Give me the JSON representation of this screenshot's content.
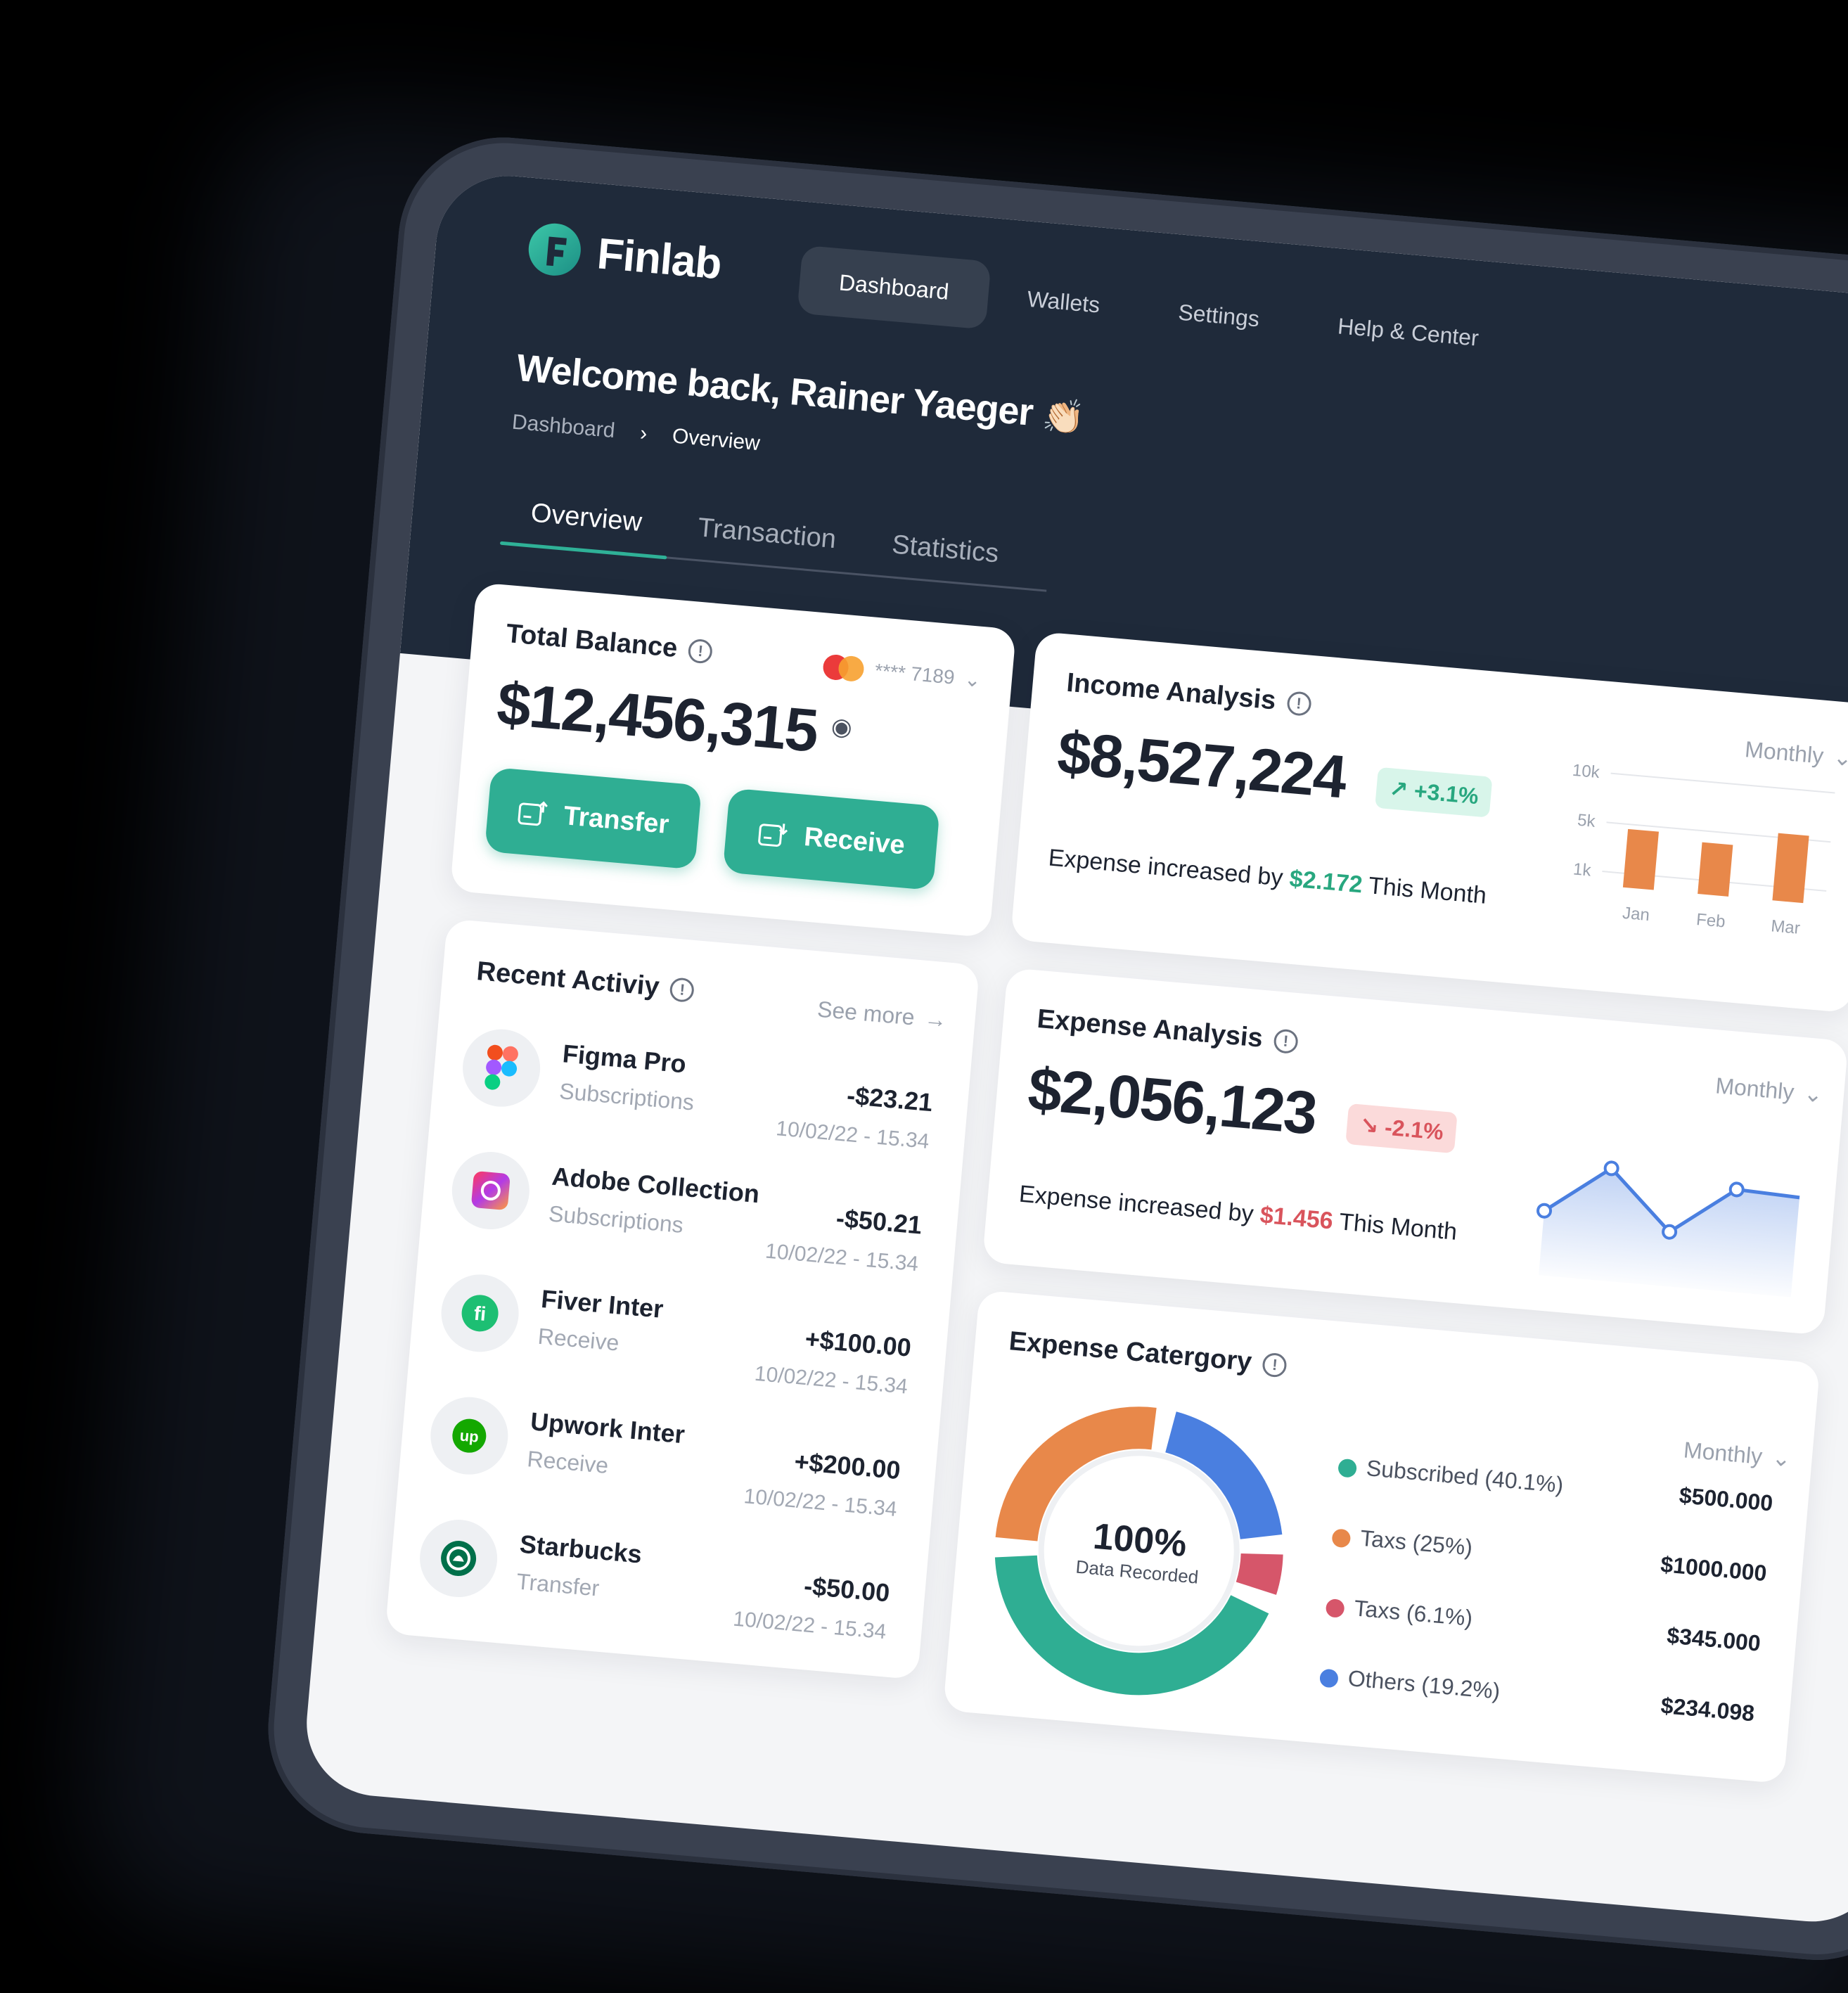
{
  "app": {
    "logo_text": "Finlab",
    "brand_color": "#2fae93",
    "dark_color": "#1f2a3a"
  },
  "nav": {
    "items": [
      {
        "label": "Dashboard",
        "active": true
      },
      {
        "label": "Wallets",
        "active": false
      },
      {
        "label": "Settings",
        "active": false
      },
      {
        "label": "Help & Center",
        "active": false
      }
    ]
  },
  "header": {
    "welcome": "Welcome back, Rainer Yaeger",
    "wave_emoji": "👏🏻",
    "breadcrumb": [
      "Dashboard",
      "Overview"
    ]
  },
  "tabs": [
    {
      "label": "Overview",
      "active": true
    },
    {
      "label": "Transaction",
      "active": false
    },
    {
      "label": "Statistics",
      "active": false
    }
  ],
  "balance": {
    "title": "Total Balance",
    "card_number": "**** 7189",
    "amount": "$12,456,315",
    "transfer_label": "Transfer",
    "receive_label": "Receive"
  },
  "income": {
    "title": "Income Analysis",
    "amount": "$8,527,224",
    "change": "+3.1%",
    "note_prefix": "Expense increased by",
    "note_value": "$2.172",
    "note_suffix": "This Month",
    "period": "Monthly",
    "chart_data": {
      "type": "bar",
      "categories": [
        "Jan",
        "Feb",
        "Mar"
      ],
      "values": [
        5.2,
        4.6,
        6.0
      ],
      "y_ticks": [
        "10k",
        "5k",
        "1k"
      ],
      "bar_color": "#e8884a"
    }
  },
  "expense": {
    "title": "Expense Analysis",
    "amount": "$2,056,123",
    "change": "-2.1%",
    "note_prefix": "Expense increased by",
    "note_value": "$1.456",
    "note_suffix": "This Month",
    "period": "Monthly",
    "chart_data": {
      "type": "line",
      "values": [
        40,
        78,
        32,
        70,
        68
      ],
      "line_color": "#4a7fe0"
    }
  },
  "category": {
    "title": "Expense Catergory",
    "period": "Monthly",
    "center_value": "100%",
    "center_label": "Data Recorded",
    "items": [
      {
        "label": "Subscribed (40.1%)",
        "value": "$500.000",
        "color": "#2fae93",
        "share": 40.1
      },
      {
        "label": "Taxs (25%)",
        "value": "$1000.000",
        "color": "#e8884a",
        "share": 25
      },
      {
        "label": "Taxs (6.1%)",
        "value": "$345.000",
        "color": "#d6566a",
        "share": 6.1
      },
      {
        "label": "Others (19.2%)",
        "value": "$234.098",
        "color": "#4a7fe0",
        "share": 19.2
      }
    ]
  },
  "activity": {
    "title": "Recent Activiy",
    "see_more": "See more",
    "items": [
      {
        "name": "Figma Pro",
        "type": "Subscriptions",
        "amount": "-$23.21",
        "date": "10/02/22 - 15.34",
        "icon": "figma-icon"
      },
      {
        "name": "Adobe Collection",
        "type": "Subscriptions",
        "amount": "-$50.21",
        "date": "10/02/22 - 15.34",
        "icon": "adobe-icon"
      },
      {
        "name": "Fiver Inter",
        "type": "Receive",
        "amount": "+$100.00",
        "date": "10/02/22 - 15.34",
        "icon": "fiverr-icon"
      },
      {
        "name": "Upwork Inter",
        "type": "Receive",
        "amount": "+$200.00",
        "date": "10/02/22 - 15.34",
        "icon": "upwork-icon"
      },
      {
        "name": "Starbucks",
        "type": "Transfer",
        "amount": "-$50.00",
        "date": "10/02/22 - 15.34",
        "icon": "starbucks-icon"
      }
    ]
  }
}
